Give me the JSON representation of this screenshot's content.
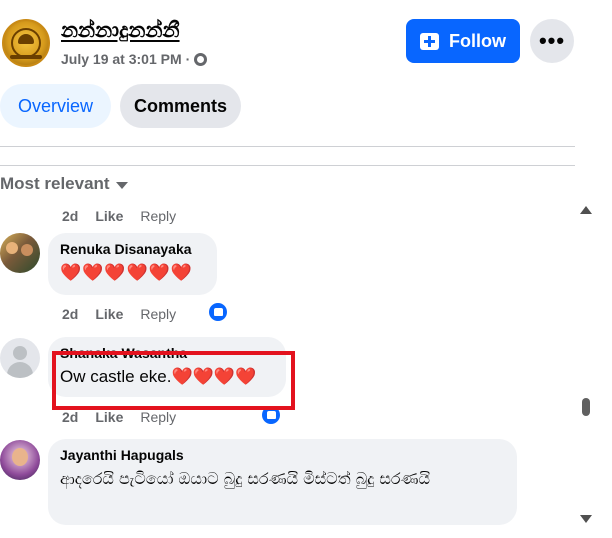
{
  "page": {
    "name": "නන්නාදුනන්නී",
    "date": "July 19 at 3:01 PM",
    "separator": "·",
    "privacy_icon": "globe-icon"
  },
  "header": {
    "follow_label": "Follow",
    "follow_icon": "follow-plus-icon",
    "more_label": "•••"
  },
  "tabs": [
    {
      "label": "Overview",
      "active": true
    },
    {
      "label": "Comments",
      "active": false
    }
  ],
  "sort": {
    "label": "Most relevant",
    "icon": "caret-down-icon"
  },
  "comments": [
    {
      "author": "",
      "text": "",
      "time": "2d",
      "like": "Like",
      "reply": "Reply",
      "partial": true
    },
    {
      "author": "Renuka Disanayaka",
      "text": "❤️❤️❤️❤️❤️❤️",
      "time": "2d",
      "like": "Like",
      "reply": "Reply",
      "reaction_icon": "like-icon"
    },
    {
      "author": "Shanaka Wasantha",
      "text": "Ow castle eke.❤️❤️❤️❤️",
      "time": "2d",
      "like": "Like",
      "reply": "Reply",
      "reaction_icon": "like-icon",
      "highlighted": true
    },
    {
      "author": "Jayanthi Hapugals",
      "text": "ආදරෙයි පැටියෝ ඔයාට බුදු සරණයි මිස්ටත් බුදු සරණයි"
    }
  ],
  "colors": {
    "accent": "#0866ff",
    "highlight": "#e3121e",
    "bubble": "#f0f2f5",
    "muted": "#65676b"
  }
}
